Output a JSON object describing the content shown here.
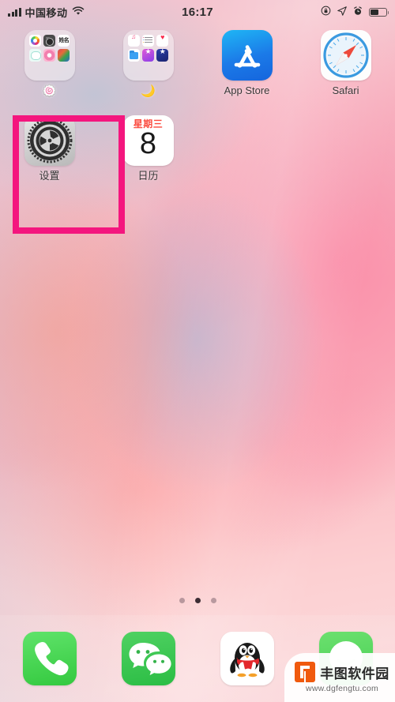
{
  "device": {
    "platform": "ios-home-screen"
  },
  "status_bar": {
    "carrier": "中国移动",
    "signal_icon": "signal-bars-icon",
    "wifi_icon": "wifi-icon",
    "time": "16:17",
    "rotation_lock_icon": "rotation-lock-icon",
    "location_icon": "location-arrow-icon",
    "alarm_icon": "alarm-clock-icon",
    "battery_icon": "battery-icon",
    "battery_level_percent": 55
  },
  "home": {
    "rows": [
      {
        "apps": [
          {
            "name": "folder-1",
            "label": "🍥",
            "type": "folder",
            "icon": "folder-icon"
          },
          {
            "name": "folder-2",
            "label": "🌙",
            "type": "folder",
            "icon": "folder-icon"
          },
          {
            "name": "app-store",
            "label": "App Store",
            "type": "app",
            "icon": "app-store-icon"
          },
          {
            "name": "safari",
            "label": "Safari",
            "type": "app",
            "icon": "safari-icon"
          }
        ]
      },
      {
        "apps": [
          {
            "name": "settings",
            "label": "设置",
            "type": "app",
            "icon": "settings-gear-icon"
          },
          {
            "name": "calendar",
            "label": "日历",
            "type": "app",
            "icon": "calendar-icon"
          }
        ]
      }
    ],
    "folder_1_mini_icons": [
      "photos-icon",
      "camera-icon",
      "news-icon",
      "snap-icon",
      "pink-app-icon",
      "art-app-icon"
    ],
    "folder_2_mini_icons": [
      "music-icon",
      "reminders-icon",
      "health-icon",
      "files-icon",
      "itunes-store-icon",
      "app-store-alt-icon"
    ],
    "calendar": {
      "weekday": "星期三",
      "day": "8"
    },
    "page_dots": {
      "count": 3,
      "active_index": 1
    }
  },
  "highlight": {
    "target": "settings",
    "color": "#f4167e"
  },
  "dock": {
    "apps": [
      {
        "name": "phone",
        "icon": "phone-handset-icon"
      },
      {
        "name": "wechat",
        "icon": "wechat-bubbles-icon"
      },
      {
        "name": "qq",
        "icon": "qq-penguin-icon"
      },
      {
        "name": "green-app",
        "icon": "green-app-icon"
      }
    ]
  },
  "watermark": {
    "site_name": "丰图软件园",
    "url": "www.dgfengtu.com",
    "logo_icon": "fengtu-logo-icon"
  }
}
